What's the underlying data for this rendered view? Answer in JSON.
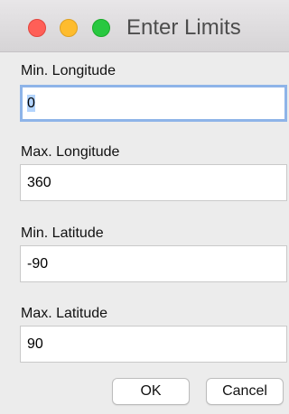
{
  "window": {
    "title": "Enter Limits"
  },
  "fields": [
    {
      "label": "Min. Longitude",
      "value": "0"
    },
    {
      "label": "Max. Longitude",
      "value": "360"
    },
    {
      "label": "Min. Latitude",
      "value": "-90"
    },
    {
      "label": "Max. Latitude",
      "value": "90"
    }
  ],
  "buttons": {
    "ok": "OK",
    "cancel": "Cancel"
  },
  "colors": {
    "close": "#ff5f57",
    "minimize": "#febc2e",
    "zoom": "#28c840",
    "focus_ring": "#8eb4e8",
    "selection": "#b3d4fd"
  }
}
